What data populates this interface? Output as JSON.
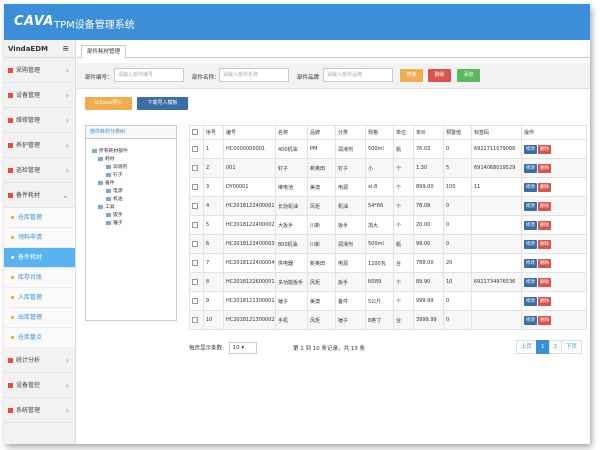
{
  "app": {
    "logo": "CAVA",
    "title": "TPM设备管理系统"
  },
  "sidebar": {
    "brand": "VindaEDM",
    "toggle_icon": "≡",
    "items": [
      {
        "label": "采购管理"
      },
      {
        "label": "设备管理"
      },
      {
        "label": "维修管理"
      },
      {
        "label": "养护管理"
      },
      {
        "label": "巡检管理"
      },
      {
        "label": "备件耗材"
      }
    ],
    "sub_items": [
      {
        "label": "仓库管理"
      },
      {
        "label": "领料申请"
      },
      {
        "label": "备件耗材"
      },
      {
        "label": "库存台账"
      },
      {
        "label": "入库管理"
      },
      {
        "label": "出库管理"
      },
      {
        "label": "仓库盘点"
      }
    ],
    "items_bottom": [
      {
        "label": "统计分析"
      },
      {
        "label": "设备管控"
      },
      {
        "label": "系统管理"
      }
    ]
  },
  "tabs": [
    {
      "label": "部件耗材管理"
    }
  ],
  "filter": {
    "code_label": "部件编号：",
    "code_placeholder": "请输入部件编号",
    "name_label": "部件名称：",
    "name_placeholder": "请输入部件名称",
    "brand_label": "部件品牌",
    "brand_placeholder": "请输入部件品牌",
    "search_btn": "搜索",
    "delete_btn": "删除",
    "add_btn": "添加"
  },
  "actions": {
    "import_btn": "从Excel导入",
    "template_btn": "下载导入模板"
  },
  "tree": {
    "title": "部件耗材分类树",
    "nodes": [
      "所有耗材部件",
      "耗材",
      "润滑剂",
      "钉子",
      "备件",
      "电源",
      "机油",
      "工具",
      "扳手",
      "锤子"
    ]
  },
  "table": {
    "headers": [
      "",
      "序号",
      "编号",
      "名称",
      "品牌",
      "分类",
      "规格",
      "单位",
      "单价",
      "预警值",
      "标签码",
      "操作"
    ],
    "rows": [
      [
        "1",
        "HC0000000001",
        "400机油",
        "PM",
        "润滑剂",
        "500ml",
        "瓶",
        "76.03",
        "0",
        "6922711079066"
      ],
      [
        "2",
        "001",
        "钉子",
        "新奥田",
        "钉子",
        "小",
        "个",
        "1.30",
        "5",
        "6914068019529"
      ],
      [
        "3",
        "DY00001",
        "维电池",
        "美澳",
        "电源",
        "xl-8",
        "个",
        "899.00",
        "100",
        "11"
      ],
      [
        "4",
        "HC2018122400001",
        "长効机油",
        "风炬",
        "机油",
        "54*66",
        "个",
        "78.08",
        "0",
        ""
      ],
      [
        "5",
        "HC2018122400002",
        "大扳手",
        "川新",
        "扳手",
        "加大",
        "个",
        "20.00",
        "0",
        ""
      ],
      [
        "6",
        "HC2018122400003",
        "800机油",
        "川新",
        "润滑剂",
        "500ml",
        "瓶",
        "99.00",
        "0",
        ""
      ],
      [
        "7",
        "HC2018122400004",
        "供电器",
        "新奥田",
        "电源",
        "1200瓦",
        "台",
        "788.00",
        "20",
        ""
      ],
      [
        "8",
        "HC2018122600001",
        "多功能扳手",
        "风炬",
        "扳手",
        "N589",
        "个",
        "89.90",
        "10",
        "6921734976536"
      ],
      [
        "9",
        "HC2018121300001",
        "锤子",
        "美澳",
        "备件",
        "5公斤",
        "个",
        "999.99",
        "0",
        ""
      ],
      [
        "10",
        "HC2018121300002",
        "手机",
        "风炬",
        "锤子",
        "8英寸",
        "台",
        "3999.99",
        "0",
        ""
      ]
    ],
    "edit_btn": "修改",
    "delete_btn": "删除"
  },
  "pagination": {
    "pagesize_label": "每页显示条数:",
    "pagesize_value": "10",
    "info": "第 1 到 10 条记录，共 13 条",
    "prev": "上页",
    "pages": [
      "1",
      "2"
    ],
    "next": "下页"
  },
  "colors": {
    "header": "#3a8fd8",
    "search": "#f0ad4e",
    "delete": "#d9534f",
    "add": "#5cb85c",
    "edit": "#3a6ea5"
  }
}
